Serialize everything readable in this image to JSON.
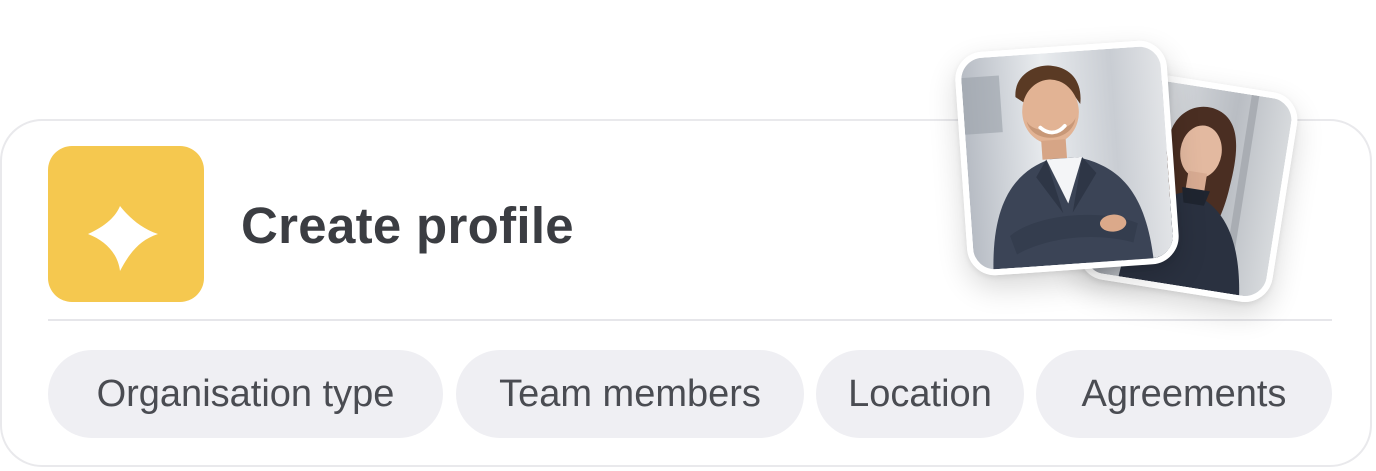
{
  "card": {
    "title": "Create profile",
    "icon": "sparkle-icon",
    "icon_color": "#f5c84f"
  },
  "chips": [
    {
      "label": "Organisation type"
    },
    {
      "label": "Team members"
    },
    {
      "label": "Location"
    },
    {
      "label": "Agreements"
    }
  ],
  "photos": [
    {
      "subject": "man in blue suit, arms crossed"
    },
    {
      "subject": "woman in dark knit sweater"
    }
  ]
}
